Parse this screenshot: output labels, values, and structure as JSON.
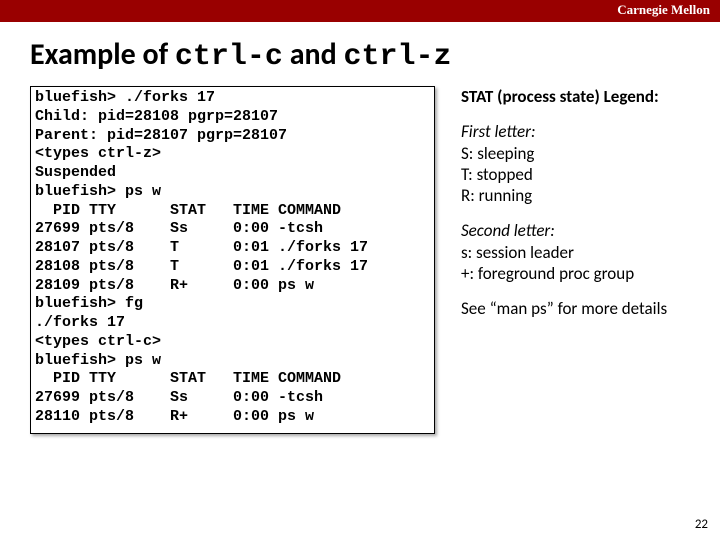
{
  "brand": "Carnegie Mellon",
  "title_pre": "Example of ",
  "title_c1": "ctrl-c",
  "title_mid": " and ",
  "title_c2": "ctrl-z",
  "term": "bluefish> ./forks 17\nChild: pid=28108 pgrp=28107\nParent: pid=28107 pgrp=28107\n<types ctrl-z>\nSuspended\nbluefish> ps w\n  PID TTY      STAT   TIME COMMAND\n27699 pts/8    Ss     0:00 -tcsh\n28107 pts/8    T      0:01 ./forks 17\n28108 pts/8    T      0:01 ./forks 17\n28109 pts/8    R+     0:00 ps w\nbluefish> fg\n./forks 17\n<types ctrl-c>\nbluefish> ps w\n  PID TTY      STAT   TIME COMMAND\n27699 pts/8    Ss     0:00 -tcsh\n28110 pts/8    R+     0:00 ps w",
  "legend": {
    "header": "STAT (process state) Legend:",
    "first_label": "First letter:",
    "first_s": "S: sleeping",
    "first_t": "T: stopped",
    "first_r": "R: running",
    "second_label": "Second letter:",
    "second_s": "s: session leader",
    "second_plus": "+: foreground proc group",
    "see": "See “man ps” for more details"
  },
  "page": "22"
}
